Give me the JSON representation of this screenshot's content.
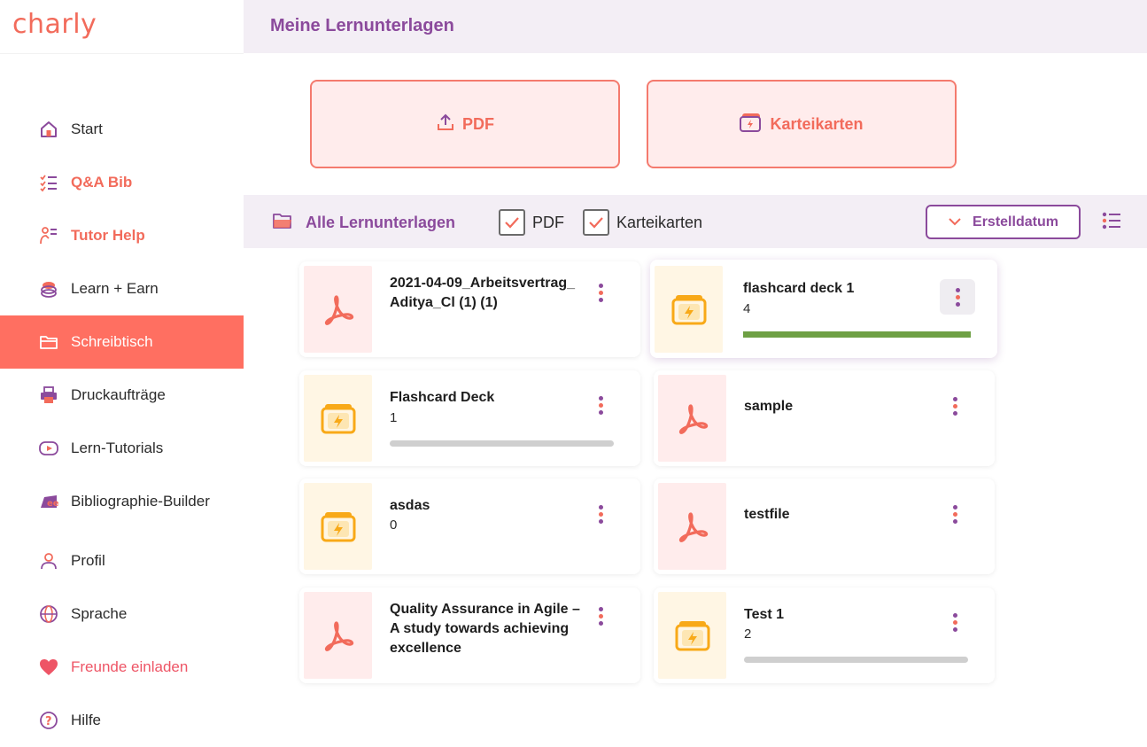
{
  "app": {
    "logo": "charly"
  },
  "header": {
    "title": "Meine Lernunterlagen"
  },
  "sidebar": {
    "items": [
      {
        "label": "Start",
        "icon": "home-icon"
      },
      {
        "label": "Q&A Bib",
        "icon": "checklist-icon"
      },
      {
        "label": "Tutor Help",
        "icon": "tutor-icon"
      },
      {
        "label": "Learn + Earn",
        "icon": "coins-icon"
      },
      {
        "label": "Schreibtisch",
        "icon": "folder-icon",
        "active": true
      },
      {
        "label": "Druckaufträge",
        "icon": "printer-icon"
      },
      {
        "label": "Lern-Tutorials",
        "icon": "play-icon"
      },
      {
        "label": "Bibliographie-Builder",
        "icon": "quote-icon"
      },
      {
        "label": "Profil",
        "icon": "user-icon"
      },
      {
        "label": "Sprache",
        "icon": "globe-icon"
      },
      {
        "label": "Freunde einladen",
        "icon": "heart-icon"
      },
      {
        "label": "Hilfe",
        "icon": "help-icon"
      }
    ]
  },
  "upload": {
    "pdf_label": "PDF",
    "deck_label": "Karteikarten"
  },
  "filters": {
    "all_label": "Alle Lernunterlagen",
    "pdf_label": "PDF",
    "deck_label": "Karteikarten",
    "pdf_checked": true,
    "deck_checked": true,
    "sort_label": "Erstelldatum"
  },
  "colors": {
    "brand_coral": "#f26b5b",
    "brand_purple": "#8b4a9c",
    "progress_green": "#6ea044"
  },
  "cards": [
    {
      "type": "pdf",
      "title": "2021-04-09_Arbeitsvertrag_Aditya_Cl (1) (1)"
    },
    {
      "type": "deck",
      "title": "flashcard deck 1",
      "count": "4",
      "progress": 1.0
    },
    {
      "type": "deck",
      "title": "Flashcard Deck",
      "count": "1",
      "progress": 0
    },
    {
      "type": "pdf",
      "title": "sample"
    },
    {
      "type": "deck",
      "title": "asdas",
      "count": "0"
    },
    {
      "type": "pdf",
      "title": "testfile"
    },
    {
      "type": "pdf",
      "title": "Quality Assurance in Agile – A study towards achieving excellence"
    },
    {
      "type": "deck",
      "title": "Test 1",
      "count": "2",
      "progress": 0
    }
  ]
}
